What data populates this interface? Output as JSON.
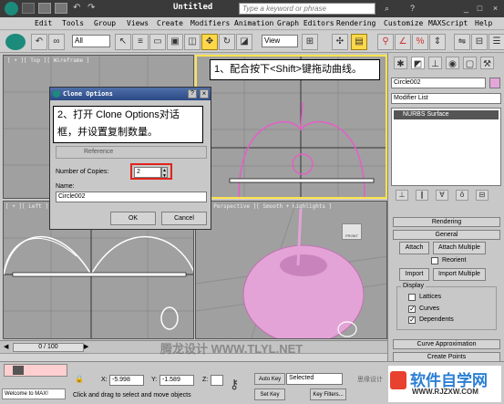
{
  "app": {
    "title": "Untitled",
    "search_placeholder": "Type a keyword or phrase"
  },
  "menu": [
    "Edit",
    "Tools",
    "Group",
    "Views",
    "Create",
    "Modifiers",
    "Animation",
    "Graph Editors",
    "Rendering",
    "Customize",
    "MAXScript",
    "Help"
  ],
  "toolbar": {
    "filter_value": "All",
    "coord_value": "View"
  },
  "viewports": {
    "top": "[ + ][ Top ][ Wireframe ]",
    "left": "[ + ][ Left ]",
    "perspective": "[ Perspective ][ Smooth + Highlights ]",
    "viewcube_label": "FRONT"
  },
  "dialog": {
    "title": "Clone Options",
    "object_group": "Reference",
    "copies_label": "Number of Copies:",
    "copies_value": "2",
    "name_label": "Name:",
    "name_value": "Circle002",
    "ok_label": "OK",
    "cancel_label": "Cancel"
  },
  "callouts": {
    "step1": "1、配合按下<Shift>键拖动曲线。",
    "step2_line1": "2、打开 Clone Options对话",
    "step2_line2": "框，并设置复制数量。"
  },
  "panel": {
    "object_name": "Circle002",
    "modifier_list": "Modifier List",
    "stack_item": "NURBS Surface",
    "rollouts": {
      "rendering": "Rendering",
      "general": "General",
      "curve_approx": "Curve Approximation",
      "create_points": "Create Points"
    },
    "attach": "Attach",
    "attach_multiple": "Attach Multiple",
    "reorient": "Reorient",
    "import": "Import",
    "import_multiple": "Import Multiple",
    "display_group": "Display",
    "lattices": "Lattices",
    "curves": "Curves",
    "dependents": "Dependents"
  },
  "timeline": {
    "frame": "0 / 100"
  },
  "status": {
    "welcome": "Welcome to MAX!",
    "prompt": "Click and drag to select and move objects",
    "x_label": "X:",
    "x_value": "-5.998",
    "y_label": "Y:",
    "y_value": "-1.589",
    "z_label": "Z:",
    "z_value": "",
    "auto_key": "Auto Key",
    "set_key": "Set Key",
    "selected": "Selected",
    "key_filters": "Key Filters..."
  },
  "watermark": {
    "center": "腾龙设计 WWW.TLYL.NET",
    "corner_brand": "软件自学网",
    "corner_url": "WWW.RJZXW.COM",
    "corner_small": "思缘设计"
  },
  "colors": {
    "accent_yellow": "#ffe34d",
    "highlight_red": "#e0241c",
    "apple_pink": "#e3a3d6"
  }
}
